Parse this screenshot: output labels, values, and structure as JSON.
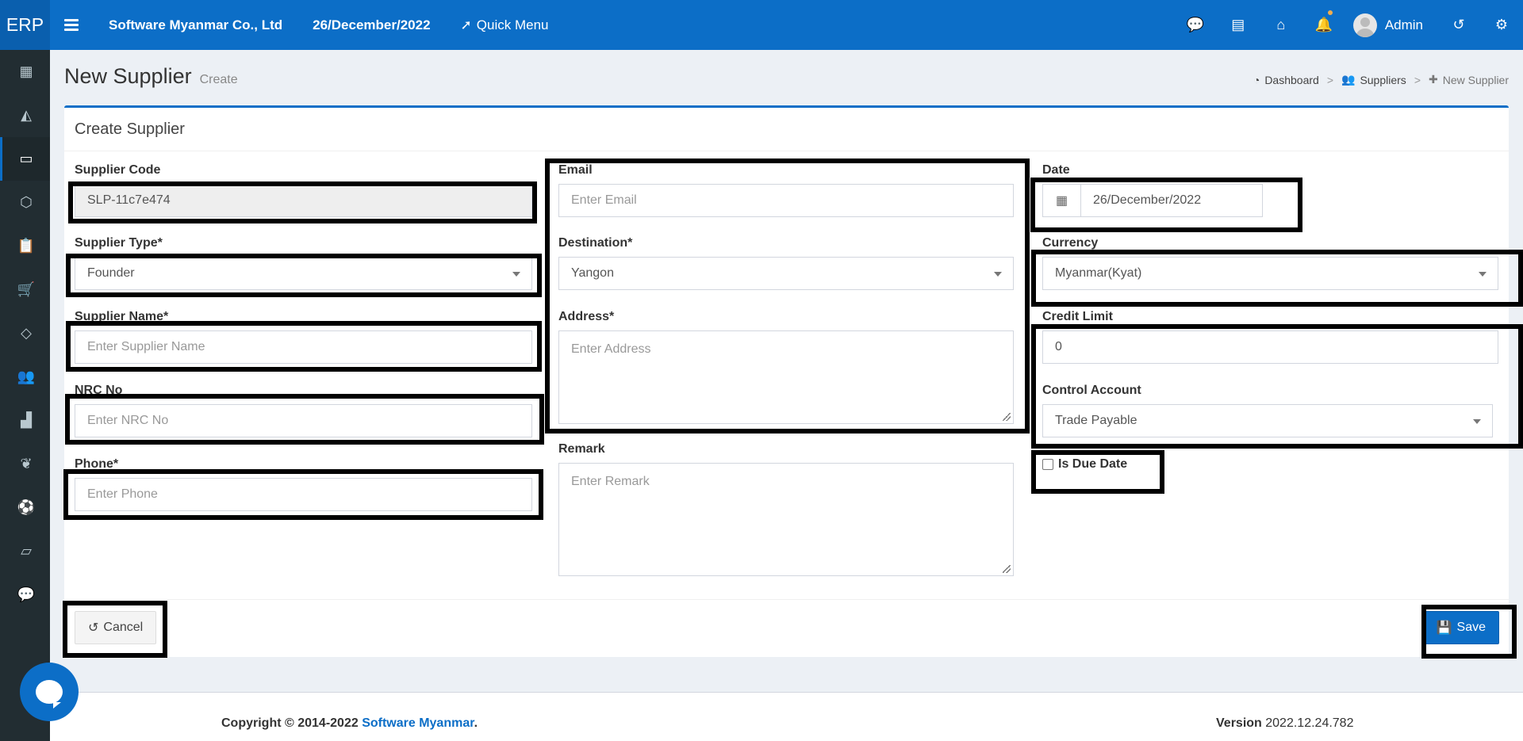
{
  "topbar": {
    "brand": "ERP",
    "company": "Software Myanmar Co., Ltd",
    "date": "26/December/2022",
    "quick_menu": "Quick Menu",
    "user": "Admin",
    "icons": [
      "chat-icon",
      "building-icon",
      "home-icon",
      "bell-icon",
      "history-icon",
      "gear-icon"
    ]
  },
  "sidebar": {
    "items": [
      "calculator-icon",
      "chart-area-icon",
      "credit-card-icon",
      "cube-icon",
      "clipboard-icon",
      "cart-icon",
      "diamond-icon",
      "users-icon",
      "industry-icon",
      "leaf-icon",
      "soccer-icon",
      "book-icon",
      "comment-icon"
    ]
  },
  "page": {
    "title": "New Supplier",
    "subtitle": "Create",
    "breadcrumb": [
      "Dashboard",
      "Suppliers",
      "New Supplier"
    ]
  },
  "form": {
    "header": "Create Supplier",
    "supplier_code": {
      "label": "Supplier Code",
      "value": "SLP-11c7e474"
    },
    "supplier_type": {
      "label": "Supplier Type*",
      "value": "Founder"
    },
    "supplier_name": {
      "label": "Supplier Name*",
      "placeholder": "Enter Supplier Name"
    },
    "nrc_no": {
      "label": "NRC No",
      "placeholder": "Enter NRC No"
    },
    "phone": {
      "label": "Phone*",
      "placeholder": "Enter Phone"
    },
    "email": {
      "label": "Email",
      "placeholder": "Enter Email"
    },
    "destination": {
      "label": "Destination*",
      "value": "Yangon"
    },
    "address": {
      "label": "Address*",
      "placeholder": "Enter Address"
    },
    "remark": {
      "label": "Remark",
      "placeholder": "Enter Remark"
    },
    "date": {
      "label": "Date",
      "value": "26/December/2022"
    },
    "currency": {
      "label": "Currency",
      "value": "Myanmar(Kyat)"
    },
    "credit_limit": {
      "label": "Credit Limit",
      "value": "0"
    },
    "control_account": {
      "label": "Control Account",
      "value": "Trade Payable"
    },
    "is_due_date": {
      "label": "Is Due Date",
      "checked": false
    },
    "cancel_label": "Cancel",
    "save_label": "Save"
  },
  "footer": {
    "copyright": "Copyright © 2014-2022 ",
    "company_link": "Software Myanmar",
    "period": ".",
    "version_label": "Version",
    "version_value": " 2022.12.24.782"
  },
  "colors": {
    "primary": "#0c6ec7",
    "sidebar": "#222d32",
    "background": "#ecf0f5"
  }
}
